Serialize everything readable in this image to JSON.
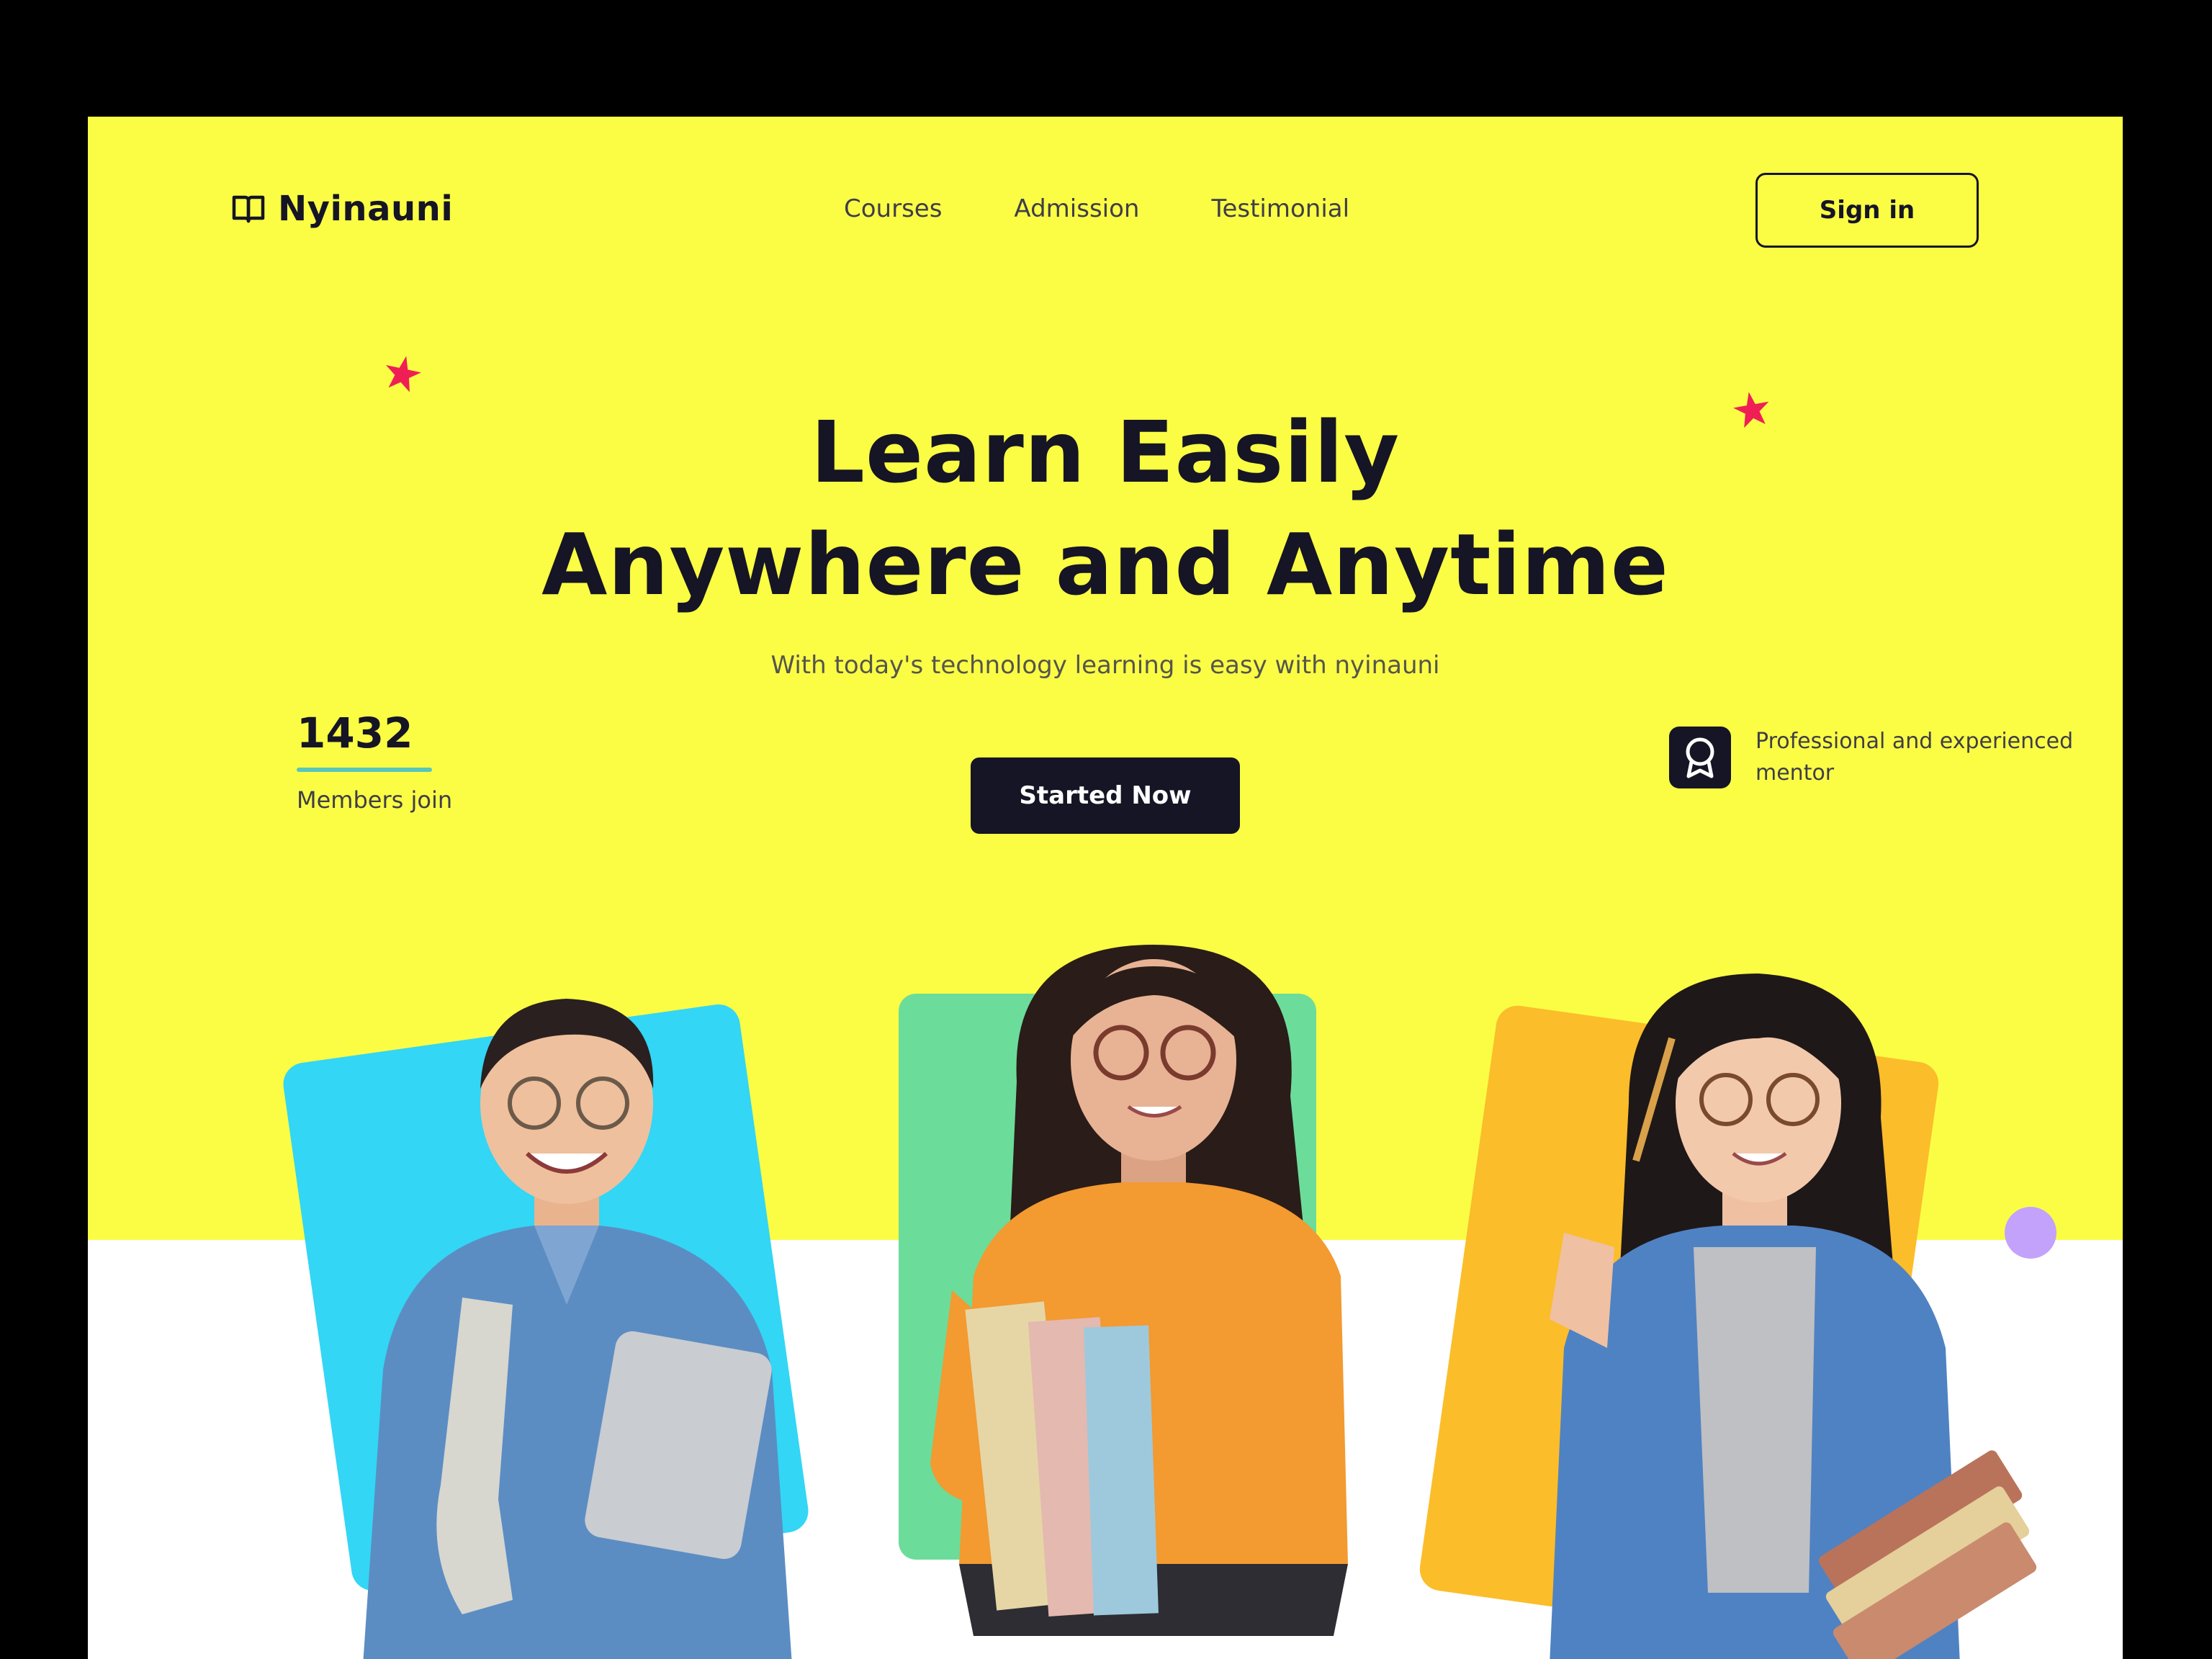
{
  "nav": {
    "brand": "Nyinauni",
    "links": [
      "Courses",
      "Admission",
      "Testimonial"
    ],
    "signin_label": "Sign in"
  },
  "hero": {
    "headline_line1": "Learn Easily",
    "headline_line2": "Anywhere and Anytime",
    "subtitle": "With today's technology learning is easy with nyinauni",
    "cta_label": "Started Now"
  },
  "stats": {
    "members_count": "1432",
    "members_label": "Members join",
    "mentor_text": "Professional and experienced mentor"
  },
  "colors": {
    "hero_yellow": "#fbfd45",
    "dark": "#151525",
    "star_red": "#ef1f55",
    "card_blue": "#33d6f4",
    "card_green": "#6cdc9a",
    "card_orange": "#fbbd2a",
    "accent_dot": "#c3a2fb"
  },
  "icons": {
    "logo": "book-icon",
    "mentor": "award-icon",
    "decor": "star-icon"
  }
}
